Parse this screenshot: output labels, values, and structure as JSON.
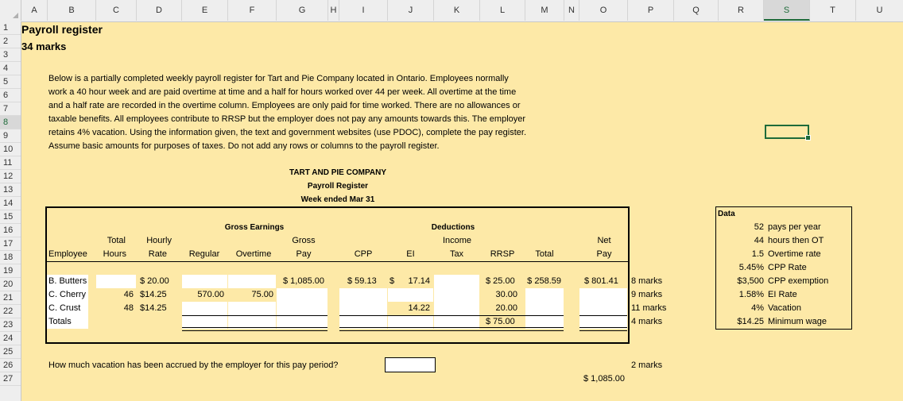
{
  "columns": [
    "A",
    "B",
    "C",
    "D",
    "E",
    "F",
    "G",
    "H",
    "I",
    "J",
    "K",
    "L",
    "M",
    "N",
    "O",
    "P",
    "Q",
    "R",
    "S",
    "T",
    "U"
  ],
  "selected_column": "S",
  "rows": [
    "1",
    "2",
    "3",
    "4",
    "5",
    "6",
    "7",
    "8",
    "9",
    "10",
    "11",
    "12",
    "13",
    "14",
    "15",
    "16",
    "17",
    "18",
    "19",
    "20",
    "21",
    "22",
    "23",
    "24",
    "25",
    "26",
    "27"
  ],
  "selected_row": "8",
  "title": "Payroll register",
  "marks_total": "34 marks",
  "instructions": [
    "Below is a partially completed weekly payroll register for Tart and Pie Company located in Ontario.  Employees normally",
    "work a 40 hour week and are paid overtime at time and a half for hours worked over 44 per week.  All overtime at the time",
    "and a half rate are recorded in the overtime column.  Employees are only paid for time worked.  There are no allowances or",
    "taxable benefits.  All employees contribute to RRSP but the employer does not pay any amounts towards this.  The employer",
    "retains 4% vacation.  Using the information given, the text and government websites (use PDOC), complete the pay register.",
    "Assume basic amounts for purposes of taxes.  Do not add any rows or columns to the payroll register."
  ],
  "company": "TART AND PIE COMPANY",
  "register_title": "Payroll Register",
  "week": "Week ended Mar 31",
  "headers": {
    "gross_earnings": "Gross Earnings",
    "deductions": "Deductions",
    "total": "Total",
    "hourly": "Hourly",
    "gross": "Gross",
    "income": "Income",
    "net": "Net",
    "employee": "Employee",
    "hours": "Hours",
    "rate": "Rate",
    "regular": "Regular",
    "overtime": "Overtime",
    "pay": "Pay",
    "cpp": "CPP",
    "ei": "EI",
    "tax": "Tax",
    "rrsp": "RRSP",
    "total2": "Total",
    "netpay": "Pay"
  },
  "employees": [
    {
      "name": "B. Butters",
      "hours": "",
      "rate": "$  20.00",
      "regular": "",
      "overtime": "",
      "gross": "$ 1,085.00",
      "cpp": "$  59.13",
      "ei_sign": "$",
      "ei": "17.14",
      "tax": "",
      "rrsp": "$  25.00",
      "total": "$ 258.59",
      "net": "$   801.41",
      "marks": "8 marks"
    },
    {
      "name": "C. Cherry",
      "hours": "46",
      "rate": "$14.25",
      "regular": "570.00",
      "overtime": "75.00",
      "gross": "",
      "cpp": "",
      "ei_sign": "",
      "ei": "",
      "tax": "",
      "rrsp": "30.00",
      "total": "",
      "net": "",
      "marks": "9 marks"
    },
    {
      "name": "C. Crust",
      "hours": "48",
      "rate": "$14.25",
      "regular": "",
      "overtime": "",
      "gross": "",
      "cpp": "",
      "ei_sign": "",
      "ei": "14.22",
      "tax": "",
      "rrsp": "20.00",
      "total": "",
      "net": "",
      "marks": "11 marks"
    },
    {
      "name": "Totals",
      "hours": "",
      "rate": "",
      "regular": "",
      "overtime": "",
      "gross": "",
      "cpp": "",
      "ei_sign": "",
      "ei": "",
      "tax": "",
      "rrsp": "$  75.00",
      "total": "",
      "net": "",
      "marks": "4 marks"
    }
  ],
  "data_box": {
    "title": "Data",
    "items": [
      {
        "value": "52",
        "label": "pays per year"
      },
      {
        "value": "44",
        "label": "hours then OT"
      },
      {
        "value": "1.5",
        "label": "Overtime rate"
      },
      {
        "value": "5.45%",
        "label": "CPP Rate"
      },
      {
        "value": "$3,500",
        "label": "CPP exemption"
      },
      {
        "value": "1.58%",
        "label": "EI Rate"
      },
      {
        "value": "4%",
        "label": "Vacation"
      },
      {
        "value": "$14.25",
        "label": "Minimum wage"
      }
    ]
  },
  "question": "How much vacation has been accrued by the employer for this pay period?",
  "question_marks": "2 marks",
  "answer_below": "$ 1,085.00"
}
